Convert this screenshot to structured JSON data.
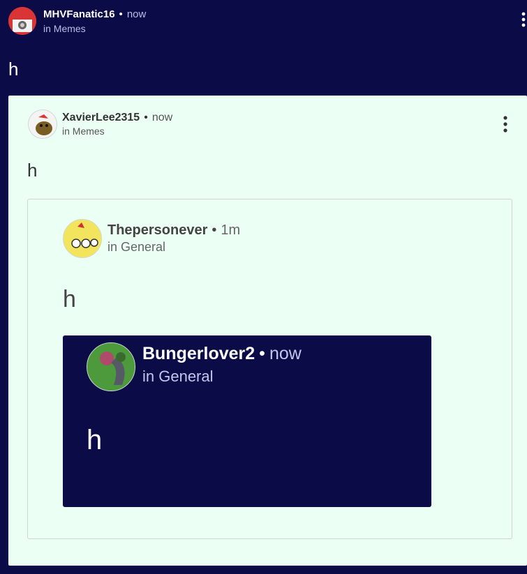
{
  "posts": [
    {
      "author": "MHVFanatic16",
      "separator": "•",
      "time": "now",
      "channel": "in Memes",
      "body": "h"
    },
    {
      "author": "XavierLee2315",
      "separator": "•",
      "time": "now",
      "channel": "in Memes",
      "body": "h"
    },
    {
      "author": "Thepersonever",
      "separator": "•",
      "time": "1m",
      "channel": "in General",
      "body": "h"
    },
    {
      "author": "Bungerlover2",
      "separator": "•",
      "time": "now",
      "channel": "in General",
      "body": "h"
    }
  ],
  "icons": {
    "menu": "kebab-menu-icon"
  },
  "colors": {
    "dark_bg": "#0b0c47",
    "light_card": "#ecfff4"
  }
}
